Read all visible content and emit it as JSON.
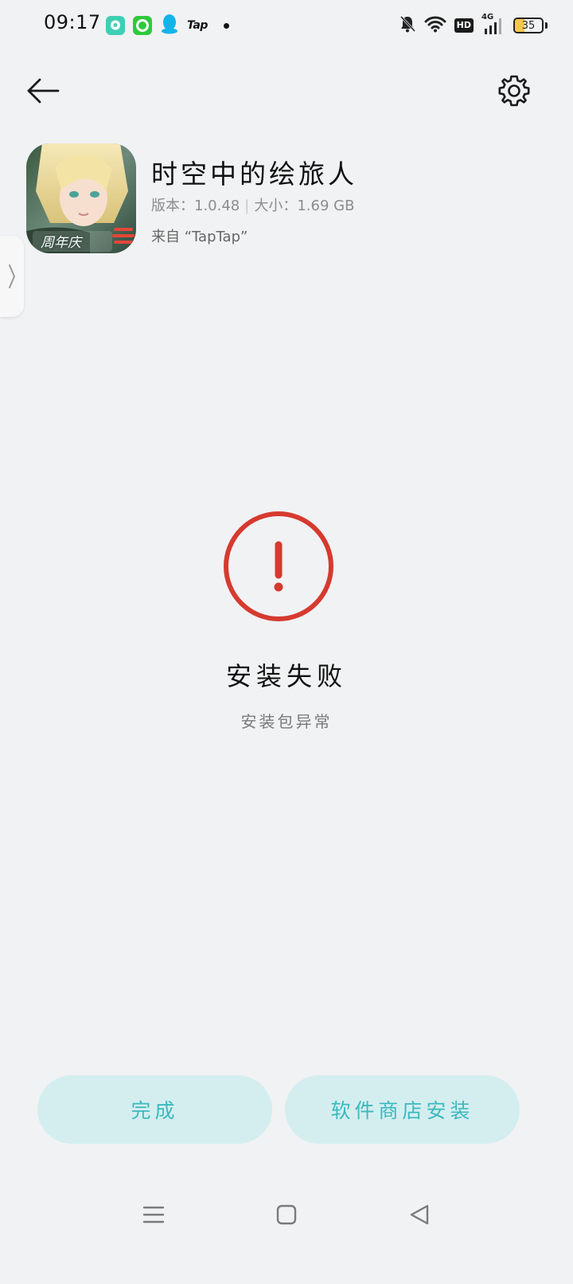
{
  "status_bar": {
    "time": "09:17",
    "notification_app_label": "Tap",
    "network_type": "4G",
    "hd_label": "HD",
    "battery_level": "35",
    "battery_fraction": 0.35,
    "icons": [
      "chat-bubble-icon",
      "green-app-icon",
      "qq-penguin-icon",
      "taptap-icon",
      "dot-icon",
      "bell-muted-icon",
      "wifi-icon",
      "hd-icon",
      "signal-icon",
      "battery-icon"
    ]
  },
  "header": {
    "back_icon": "arrow-left-icon",
    "settings_icon": "gear-icon"
  },
  "app": {
    "name": "时空中的绘旅人",
    "version_label": "版本：",
    "version": "1.0.48",
    "size_label": "大小：",
    "size": "1.69 GB",
    "source": "来自 “TapTap”",
    "icon_badge_text": "周年庆"
  },
  "status": {
    "icon": "exclamation-circle-icon",
    "title": "安装失败",
    "subtitle": "安装包异常",
    "color": "#d63a2f"
  },
  "actions": {
    "done_label": "完成",
    "store_install_label": "软件商店安装",
    "button_bg": "#d4eeef",
    "button_text_color": "#3cb9bf"
  },
  "nav": {
    "icons": [
      "menu-icon",
      "home-square-icon",
      "back-triangle-icon"
    ]
  }
}
